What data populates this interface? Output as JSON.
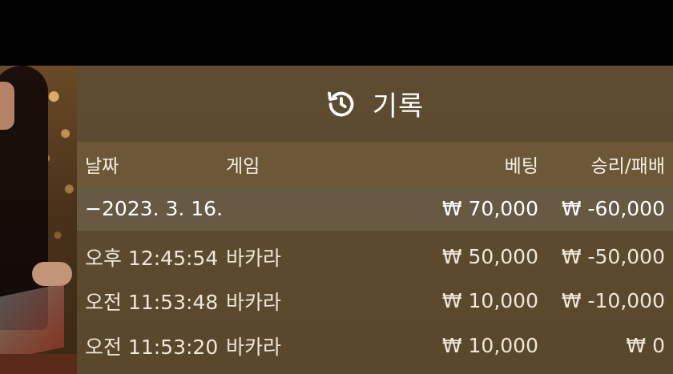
{
  "panel": {
    "title": "기록",
    "icon": "history-icon"
  },
  "columns": {
    "date": "날짜",
    "game": "게임",
    "bet": "베팅",
    "result": "승리/패배"
  },
  "date_group": {
    "date": "−2023. 3. 16.",
    "bet_total": "₩ 70,000",
    "result_total": "₩ -60,000"
  },
  "rows": [
    {
      "time": "오후 12:45:54",
      "game": "바카라",
      "bet": "₩ 50,000",
      "result": "₩ -50,000"
    },
    {
      "time": "오전 11:53:48",
      "game": "바카라",
      "bet": "₩ 10,000",
      "result": "₩ -10,000"
    },
    {
      "time": "오전 11:53:20",
      "game": "바카라",
      "bet": "₩ 10,000",
      "result": "₩ 0"
    }
  ],
  "colors": {
    "panel_bg": "#5e4c30",
    "header_row_bg": "#786440",
    "group_row_bg": "#6e6450",
    "text": "#f3ede2"
  }
}
